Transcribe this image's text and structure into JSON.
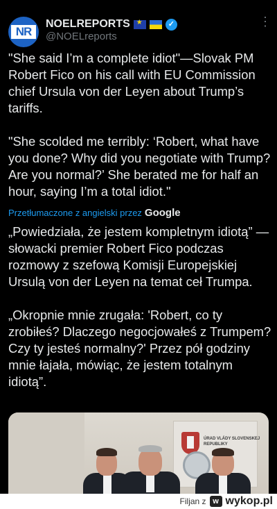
{
  "account": {
    "avatar_text": "NR",
    "display_name": "NOELREPORTS",
    "handle": "@NOELreports",
    "badges": [
      "eu-flag-icon",
      "ukraine-flag-icon",
      "verified-badge-icon"
    ]
  },
  "tweet": {
    "paragraph_1": "\"She said I’m a complete idiot\"—Slovak PM Robert Fico on his call with EU Commission chief Ursula von der Leyen about Trump’s tariffs.",
    "paragraph_2": "\"She scolded me terribly: ‘Robert, what have you done? Why did you negotiate with Trump? Are you normal?’ She berated me for half an hour, saying I’m a total idiot.\""
  },
  "translation": {
    "label": "Przetłumaczone z angielski przez",
    "provider": "Google",
    "paragraph_1": "„Powiedziała, że jestem kompletnym idiotą” — słowacki premier Robert Fico podczas rozmowy z szefową Komisji Europejskiej Ursulą von der Leyen na temat ceł Trumpa.",
    "paragraph_2": "„Okropnie mnie zrugała: 'Robert, co ty zrobiłeś? Dlaczego negocjowałeś z Trumpem? Czy ty jesteś normalny?' Przez pół godziny mnie łajała, mówiąc, że jestem totalnym idiotą”."
  },
  "media": {
    "panel_text": "ÚRAD VLÁDY SLOVENSKEJ REPUBLIKY"
  },
  "footer": {
    "credit": "Filjan z",
    "site": "wykop.pl"
  },
  "colors": {
    "background": "#000000",
    "text": "#e7e9ea",
    "secondary": "#71767b",
    "link": "#1d9bf0"
  }
}
